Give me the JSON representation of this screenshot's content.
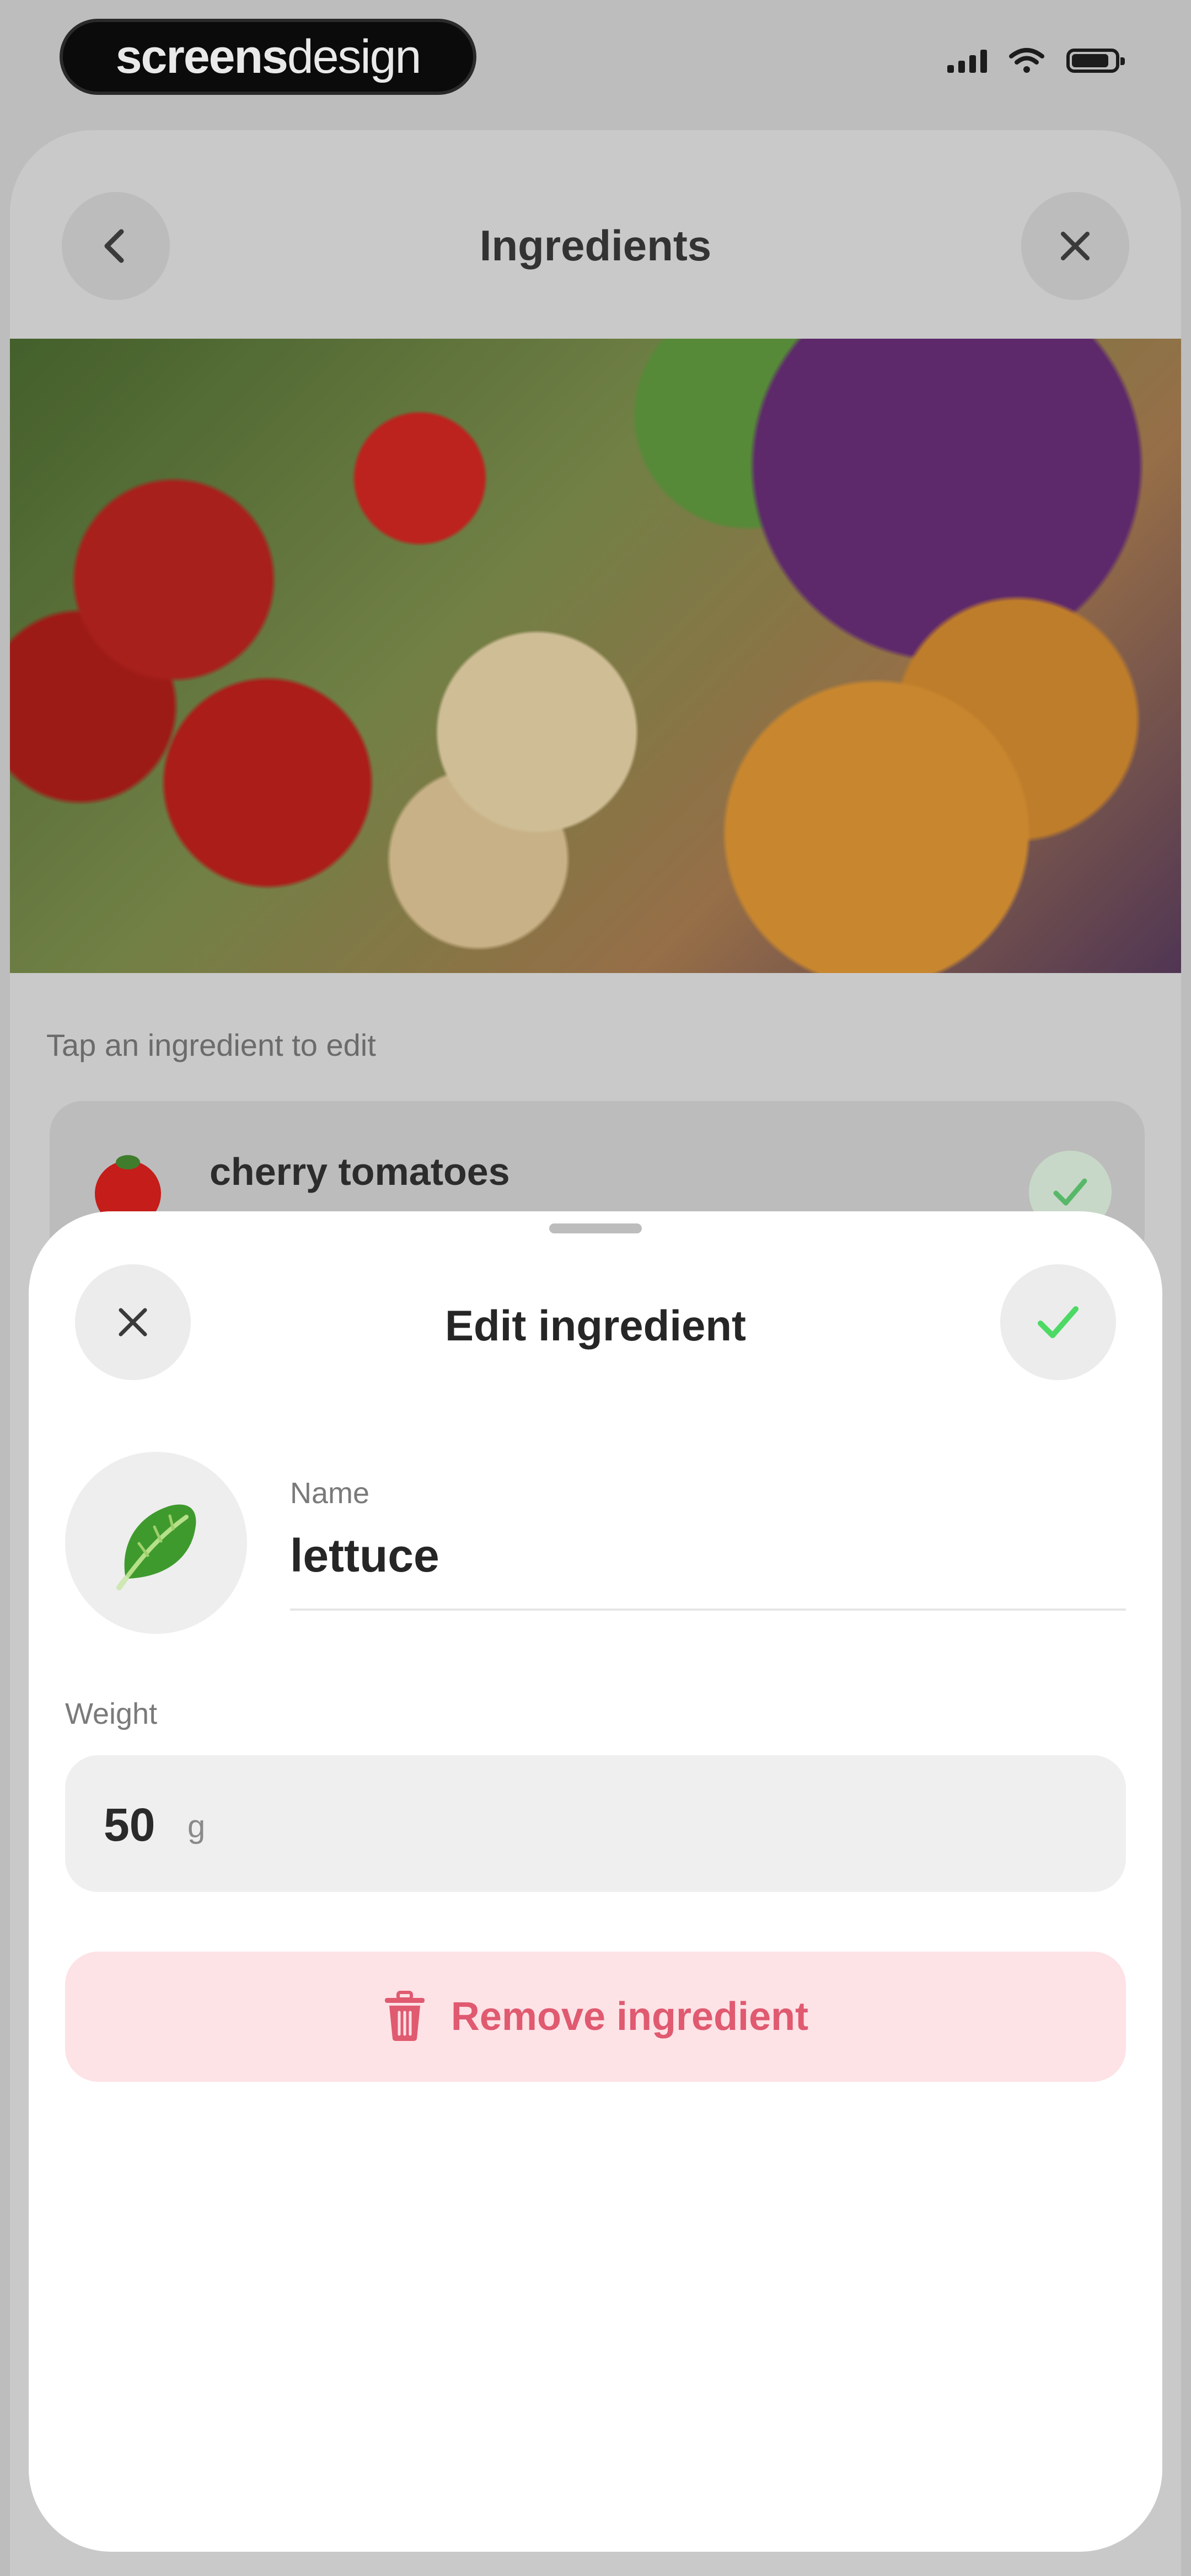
{
  "status_bar": {
    "brand_bold": "screens",
    "brand_light": "design",
    "icons": [
      "cellular-signal-icon",
      "wifi-icon",
      "battery-icon"
    ]
  },
  "background_screen": {
    "title": "Ingredients",
    "back_icon": "chevron-left-icon",
    "close_icon": "close-icon",
    "hint": "Tap an ingredient to edit",
    "ingredient_row": {
      "name": "cherry tomatoes",
      "icon": "tomato-icon"
    }
  },
  "edit_sheet": {
    "title": "Edit ingredient",
    "close_icon": "close-icon",
    "confirm_icon": "checkmark-icon",
    "ingredient_icon": "lettuce-icon",
    "name_label": "Name",
    "name_value": "lettuce",
    "weight_label": "Weight",
    "weight_value": "50",
    "weight_unit": "g",
    "remove_label": "Remove ingredient"
  },
  "colors": {
    "accent_green": "#4cd964",
    "danger": "#e05a70",
    "danger_bg": "#fde2e6"
  }
}
